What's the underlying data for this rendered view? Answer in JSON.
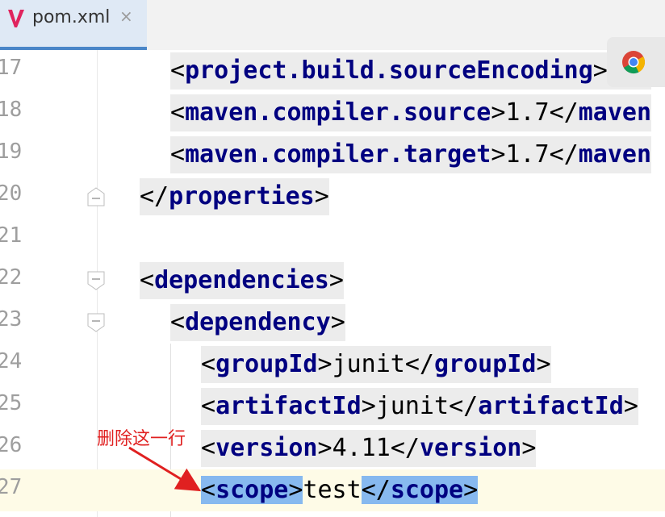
{
  "tab": {
    "label": "pom.xml",
    "close": "×",
    "accent": "#4a86c8"
  },
  "lines": [
    {
      "no": "17",
      "text": "<project.build.sourceEncoding>UTF"
    },
    {
      "no": "18",
      "text": "<maven.compiler.source>1.7</maven"
    },
    {
      "no": "19",
      "text": "<maven.compiler.target>1.7</maven"
    },
    {
      "no": "20",
      "text": "</properties>"
    },
    {
      "no": "21",
      "text": ""
    },
    {
      "no": "22",
      "text": "<dependencies>"
    },
    {
      "no": "23",
      "text": "<dependency>"
    },
    {
      "no": "24",
      "text": "<groupId>junit</groupId>"
    },
    {
      "no": "25",
      "text": "<artifactId>junit</artifactId>"
    },
    {
      "no": "26",
      "text": "<version>4.11</version>"
    },
    {
      "no": "27",
      "text": "<scope>test</scope>"
    }
  ],
  "annotation": {
    "text": "删除这一行",
    "color": "#e02020"
  },
  "colors": {
    "tag": "#000080",
    "selection": "#87b9ef",
    "current_line": "#fefbe7"
  },
  "icons": {
    "tab": "vue-v-icon",
    "popup": "chrome-icon"
  }
}
